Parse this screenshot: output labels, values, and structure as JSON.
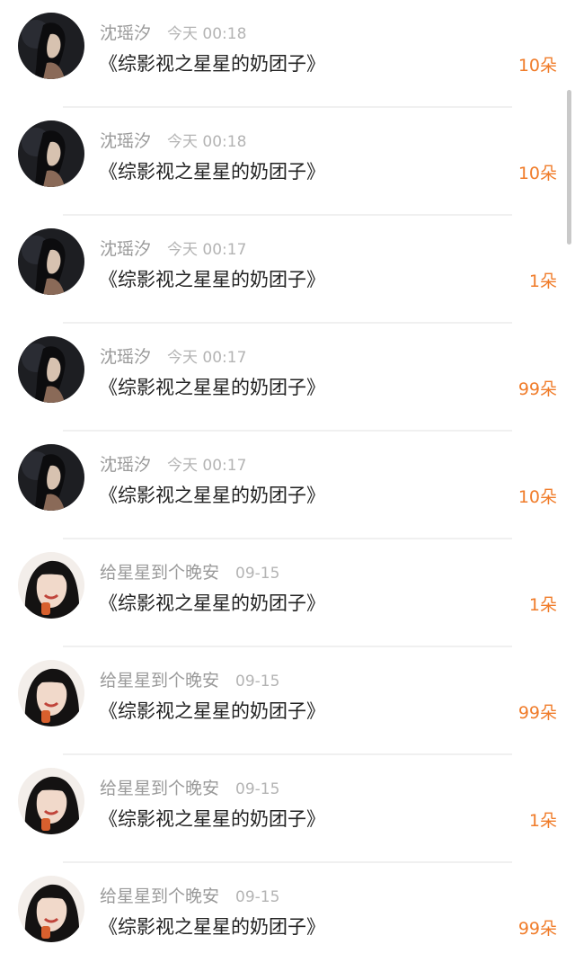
{
  "rows": [
    {
      "name": "沈瑶汐",
      "time": "今天 00:18",
      "title": "《综影视之星星的奶团子》",
      "count": "10朵",
      "avatar": "dark-portrait"
    },
    {
      "name": "沈瑶汐",
      "time": "今天 00:18",
      "title": "《综影视之星星的奶团子》",
      "count": "10朵",
      "avatar": "dark-portrait"
    },
    {
      "name": "沈瑶汐",
      "time": "今天 00:17",
      "title": "《综影视之星星的奶团子》",
      "count": "1朵",
      "avatar": "dark-portrait"
    },
    {
      "name": "沈瑶汐",
      "time": "今天 00:17",
      "title": "《综影视之星星的奶团子》",
      "count": "99朵",
      "avatar": "dark-portrait"
    },
    {
      "name": "沈瑶汐",
      "time": "今天 00:17",
      "title": "《综影视之星星的奶团子》",
      "count": "10朵",
      "avatar": "dark-portrait"
    },
    {
      "name": "给星星到个晚安",
      "time": "09-15",
      "title": "《综影视之星星的奶团子》",
      "count": "1朵",
      "avatar": "smiling-girl"
    },
    {
      "name": "给星星到个晚安",
      "time": "09-15",
      "title": "《综影视之星星的奶团子》",
      "count": "99朵",
      "avatar": "smiling-girl"
    },
    {
      "name": "给星星到个晚安",
      "time": "09-15",
      "title": "《综影视之星星的奶团子》",
      "count": "1朵",
      "avatar": "smiling-girl"
    },
    {
      "name": "给星星到个晚安",
      "time": "09-15",
      "title": "《综影视之星星的奶团子》",
      "count": "99朵",
      "avatar": "smiling-girl"
    }
  ],
  "colors": {
    "count": "#f07c2a",
    "name": "#9a9a9a",
    "time": "#b4b4b4",
    "title": "#222222",
    "divider": "#f0f0f0"
  }
}
